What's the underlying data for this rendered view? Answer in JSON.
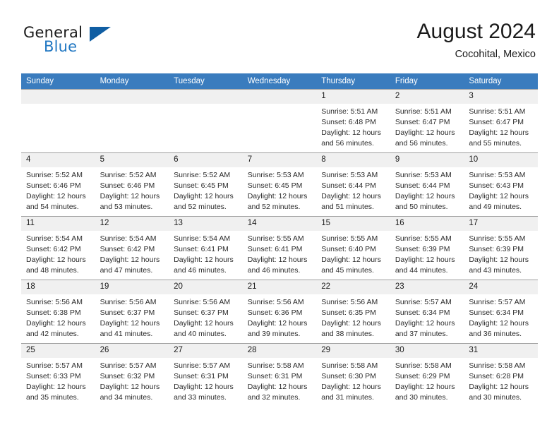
{
  "brand": {
    "word1": "General",
    "word2": "Blue",
    "mark": "triangle-logo",
    "accent": "#2077c2",
    "mark_color": "#105ea3"
  },
  "header": {
    "title": "August 2024",
    "subtitle": "Cocohital, Mexico"
  },
  "calendar": {
    "header_bg": "#3a7cbe",
    "header_text_color": "#ffffff",
    "daynum_bg": "#f0f0f0",
    "weekdays": [
      "Sunday",
      "Monday",
      "Tuesday",
      "Wednesday",
      "Thursday",
      "Friday",
      "Saturday"
    ],
    "weeks": [
      [
        {
          "day": "",
          "sunrise": "",
          "sunset": "",
          "daylight": "",
          "empty": true
        },
        {
          "day": "",
          "sunrise": "",
          "sunset": "",
          "daylight": "",
          "empty": true
        },
        {
          "day": "",
          "sunrise": "",
          "sunset": "",
          "daylight": "",
          "empty": true
        },
        {
          "day": "",
          "sunrise": "",
          "sunset": "",
          "daylight": "",
          "empty": true
        },
        {
          "day": "1",
          "sunrise": "Sunrise: 5:51 AM",
          "sunset": "Sunset: 6:48 PM",
          "daylight": "Daylight: 12 hours and 56 minutes."
        },
        {
          "day": "2",
          "sunrise": "Sunrise: 5:51 AM",
          "sunset": "Sunset: 6:47 PM",
          "daylight": "Daylight: 12 hours and 56 minutes."
        },
        {
          "day": "3",
          "sunrise": "Sunrise: 5:51 AM",
          "sunset": "Sunset: 6:47 PM",
          "daylight": "Daylight: 12 hours and 55 minutes."
        }
      ],
      [
        {
          "day": "4",
          "sunrise": "Sunrise: 5:52 AM",
          "sunset": "Sunset: 6:46 PM",
          "daylight": "Daylight: 12 hours and 54 minutes."
        },
        {
          "day": "5",
          "sunrise": "Sunrise: 5:52 AM",
          "sunset": "Sunset: 6:46 PM",
          "daylight": "Daylight: 12 hours and 53 minutes."
        },
        {
          "day": "6",
          "sunrise": "Sunrise: 5:52 AM",
          "sunset": "Sunset: 6:45 PM",
          "daylight": "Daylight: 12 hours and 52 minutes."
        },
        {
          "day": "7",
          "sunrise": "Sunrise: 5:53 AM",
          "sunset": "Sunset: 6:45 PM",
          "daylight": "Daylight: 12 hours and 52 minutes."
        },
        {
          "day": "8",
          "sunrise": "Sunrise: 5:53 AM",
          "sunset": "Sunset: 6:44 PM",
          "daylight": "Daylight: 12 hours and 51 minutes."
        },
        {
          "day": "9",
          "sunrise": "Sunrise: 5:53 AM",
          "sunset": "Sunset: 6:44 PM",
          "daylight": "Daylight: 12 hours and 50 minutes."
        },
        {
          "day": "10",
          "sunrise": "Sunrise: 5:53 AM",
          "sunset": "Sunset: 6:43 PM",
          "daylight": "Daylight: 12 hours and 49 minutes."
        }
      ],
      [
        {
          "day": "11",
          "sunrise": "Sunrise: 5:54 AM",
          "sunset": "Sunset: 6:42 PM",
          "daylight": "Daylight: 12 hours and 48 minutes."
        },
        {
          "day": "12",
          "sunrise": "Sunrise: 5:54 AM",
          "sunset": "Sunset: 6:42 PM",
          "daylight": "Daylight: 12 hours and 47 minutes."
        },
        {
          "day": "13",
          "sunrise": "Sunrise: 5:54 AM",
          "sunset": "Sunset: 6:41 PM",
          "daylight": "Daylight: 12 hours and 46 minutes."
        },
        {
          "day": "14",
          "sunrise": "Sunrise: 5:55 AM",
          "sunset": "Sunset: 6:41 PM",
          "daylight": "Daylight: 12 hours and 46 minutes."
        },
        {
          "day": "15",
          "sunrise": "Sunrise: 5:55 AM",
          "sunset": "Sunset: 6:40 PM",
          "daylight": "Daylight: 12 hours and 45 minutes."
        },
        {
          "day": "16",
          "sunrise": "Sunrise: 5:55 AM",
          "sunset": "Sunset: 6:39 PM",
          "daylight": "Daylight: 12 hours and 44 minutes."
        },
        {
          "day": "17",
          "sunrise": "Sunrise: 5:55 AM",
          "sunset": "Sunset: 6:39 PM",
          "daylight": "Daylight: 12 hours and 43 minutes."
        }
      ],
      [
        {
          "day": "18",
          "sunrise": "Sunrise: 5:56 AM",
          "sunset": "Sunset: 6:38 PM",
          "daylight": "Daylight: 12 hours and 42 minutes."
        },
        {
          "day": "19",
          "sunrise": "Sunrise: 5:56 AM",
          "sunset": "Sunset: 6:37 PM",
          "daylight": "Daylight: 12 hours and 41 minutes."
        },
        {
          "day": "20",
          "sunrise": "Sunrise: 5:56 AM",
          "sunset": "Sunset: 6:37 PM",
          "daylight": "Daylight: 12 hours and 40 minutes."
        },
        {
          "day": "21",
          "sunrise": "Sunrise: 5:56 AM",
          "sunset": "Sunset: 6:36 PM",
          "daylight": "Daylight: 12 hours and 39 minutes."
        },
        {
          "day": "22",
          "sunrise": "Sunrise: 5:56 AM",
          "sunset": "Sunset: 6:35 PM",
          "daylight": "Daylight: 12 hours and 38 minutes."
        },
        {
          "day": "23",
          "sunrise": "Sunrise: 5:57 AM",
          "sunset": "Sunset: 6:34 PM",
          "daylight": "Daylight: 12 hours and 37 minutes."
        },
        {
          "day": "24",
          "sunrise": "Sunrise: 5:57 AM",
          "sunset": "Sunset: 6:34 PM",
          "daylight": "Daylight: 12 hours and 36 minutes."
        }
      ],
      [
        {
          "day": "25",
          "sunrise": "Sunrise: 5:57 AM",
          "sunset": "Sunset: 6:33 PM",
          "daylight": "Daylight: 12 hours and 35 minutes."
        },
        {
          "day": "26",
          "sunrise": "Sunrise: 5:57 AM",
          "sunset": "Sunset: 6:32 PM",
          "daylight": "Daylight: 12 hours and 34 minutes."
        },
        {
          "day": "27",
          "sunrise": "Sunrise: 5:57 AM",
          "sunset": "Sunset: 6:31 PM",
          "daylight": "Daylight: 12 hours and 33 minutes."
        },
        {
          "day": "28",
          "sunrise": "Sunrise: 5:58 AM",
          "sunset": "Sunset: 6:31 PM",
          "daylight": "Daylight: 12 hours and 32 minutes."
        },
        {
          "day": "29",
          "sunrise": "Sunrise: 5:58 AM",
          "sunset": "Sunset: 6:30 PM",
          "daylight": "Daylight: 12 hours and 31 minutes."
        },
        {
          "day": "30",
          "sunrise": "Sunrise: 5:58 AM",
          "sunset": "Sunset: 6:29 PM",
          "daylight": "Daylight: 12 hours and 30 minutes."
        },
        {
          "day": "31",
          "sunrise": "Sunrise: 5:58 AM",
          "sunset": "Sunset: 6:28 PM",
          "daylight": "Daylight: 12 hours and 30 minutes."
        }
      ]
    ]
  }
}
